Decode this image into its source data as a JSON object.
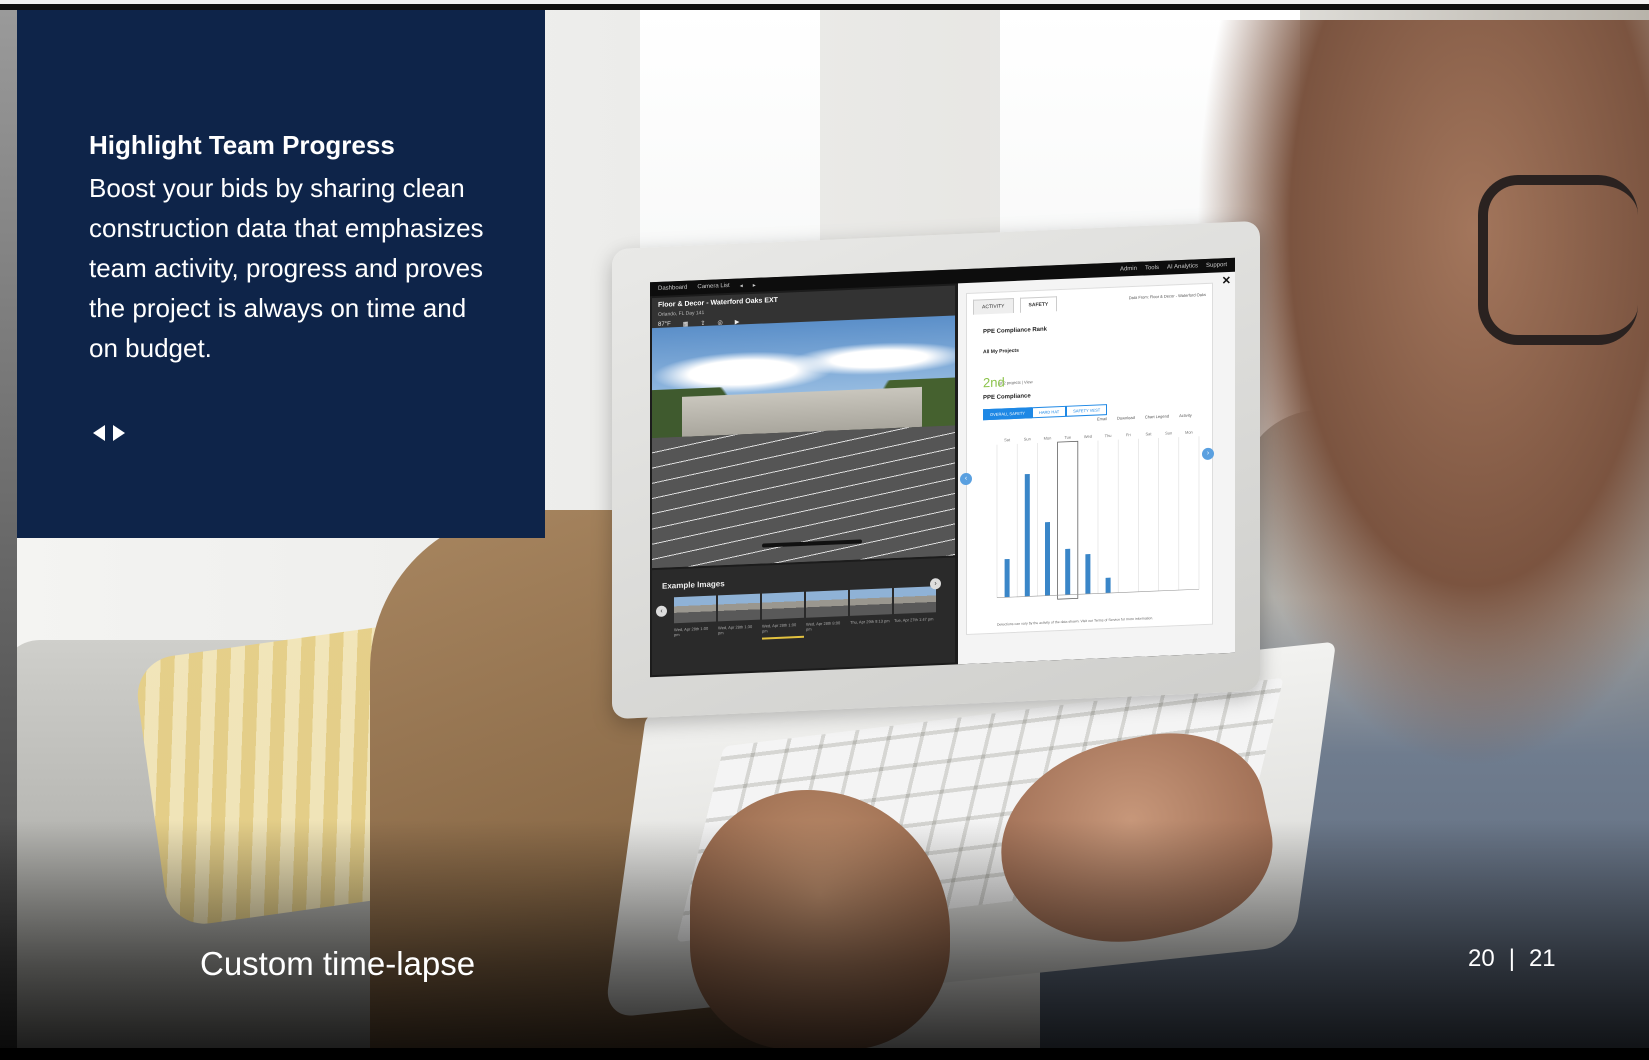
{
  "info": {
    "title": "Highlight Team Progress",
    "body": "Boost your bids by sharing clean construction data that emphasizes team activity, progress and proves the project is always on time and on budget.",
    "prev_icon": "triangle-left",
    "next_icon": "triangle-right"
  },
  "caption": "Custom time-lapse",
  "pager": {
    "left": "20",
    "sep": "|",
    "right": "21"
  },
  "screen": {
    "topnav": [
      "Dashboard",
      "Camera List",
      "◂",
      "▸"
    ],
    "topright": [
      "Admin",
      "Tools",
      "AI Analytics",
      "Support"
    ],
    "camera": {
      "title": "Floor & Decor - Waterford Oaks EXT",
      "subtitle": "Orlando, FL    Day 141",
      "temp": "87°F"
    },
    "examples": {
      "title": "Example Images",
      "captions": [
        "Wed, Apr 28th 1:00 pm",
        "Wed, Apr 28th 1:30 pm",
        "Wed, Apr 28th 1:00 pm",
        "Wed, Apr 28th 8:00 pm",
        "Thu, Apr 29th 9:13 pm",
        "Tue, Apr 27th 1:47 pm"
      ]
    },
    "panel": {
      "tabs": [
        "ACTIVITY",
        "SAFETY"
      ],
      "data_from": "Data From: Floor & Decor - Waterford Oaks",
      "rank_heading": "PPE Compliance Rank",
      "all_projects": "All My Projects",
      "rank": "2nd",
      "rank_sub": "of 2 projects  |  View",
      "compliance_heading": "PPE Compliance",
      "segments": [
        "OVERALL SAFETY",
        "HARD HAT",
        "SAFETY VEST"
      ],
      "legend": [
        "Email",
        "Download",
        "Chart Legend",
        "Activity"
      ],
      "disclaimer": "Detections can vary by the activity of the data shown. Visit our Terms of Service for more information."
    }
  },
  "chart_data": {
    "type": "bar",
    "categories": [
      "Sat",
      "Sun",
      "Mon",
      "Tue",
      "Wed",
      "Thu",
      "Fri",
      "Sat",
      "Sun",
      "Mon"
    ],
    "values": [
      25,
      80,
      48,
      30,
      26,
      10,
      0,
      0,
      0,
      0
    ],
    "ylim": [
      0,
      100
    ],
    "color": "#3a86c8"
  },
  "colors": {
    "panel_navy": "#0e2449",
    "accent_blue": "#1e88e5",
    "rank_green": "#8bc34a"
  }
}
